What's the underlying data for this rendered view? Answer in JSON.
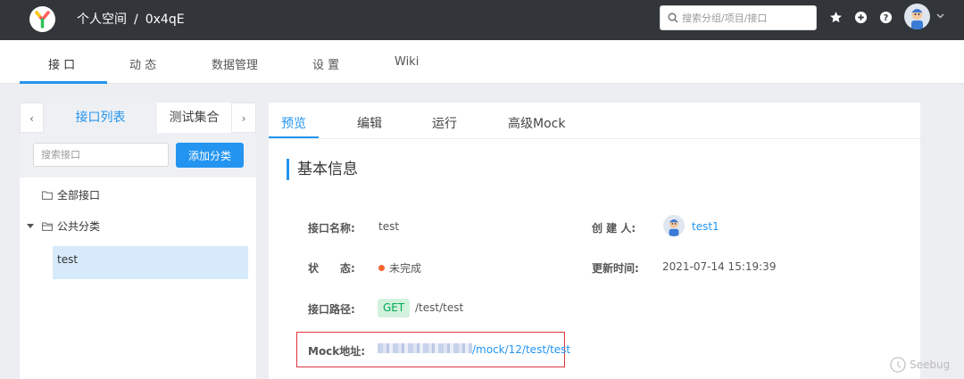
{
  "header": {
    "breadcrumb_space": "个人空间",
    "breadcrumb_sep": "/",
    "breadcrumb_project": "0x4qE",
    "search_placeholder": "搜索分组/项目/接口"
  },
  "subnav": {
    "tabs": [
      {
        "label": "接 口"
      },
      {
        "label": "动 态"
      },
      {
        "label": "数据管理"
      },
      {
        "label": "设 置"
      },
      {
        "label": "Wiki"
      }
    ]
  },
  "left_panel": {
    "prev_arrow": "‹",
    "next_arrow": "›",
    "tab_active": "接口列表",
    "tab_other": "测试集合",
    "search_placeholder": "搜索接口",
    "add_button": "添加分类",
    "tree": {
      "all": "全部接口",
      "category": "公共分类",
      "leaf": "test"
    }
  },
  "detail": {
    "tabs": [
      {
        "label": "预览"
      },
      {
        "label": "编辑"
      },
      {
        "label": "运行"
      },
      {
        "label": "高级Mock"
      }
    ],
    "section_title": "基本信息",
    "name_label": "接口名称:",
    "name_value": "test",
    "creator_label": "创 建 人:",
    "creator_value": "test1",
    "status_label": "状　　态:",
    "status_value": "未完成",
    "updated_label": "更新时间:",
    "updated_value": "2021-07-14 15:19:39",
    "path_label": "接口路径:",
    "method": "GET",
    "path_value": "/test/test",
    "mock_label": "Mock地址:",
    "mock_value": "/mock/12/test/test"
  },
  "watermark": "Seebug",
  "colors": {
    "accent": "#2395f1",
    "header_bg": "#32363a",
    "status_dot": "#f5662f",
    "get_badge_bg": "#d2f2dd",
    "get_badge_text": "#00a854",
    "highlight_box": "#e0343f"
  }
}
